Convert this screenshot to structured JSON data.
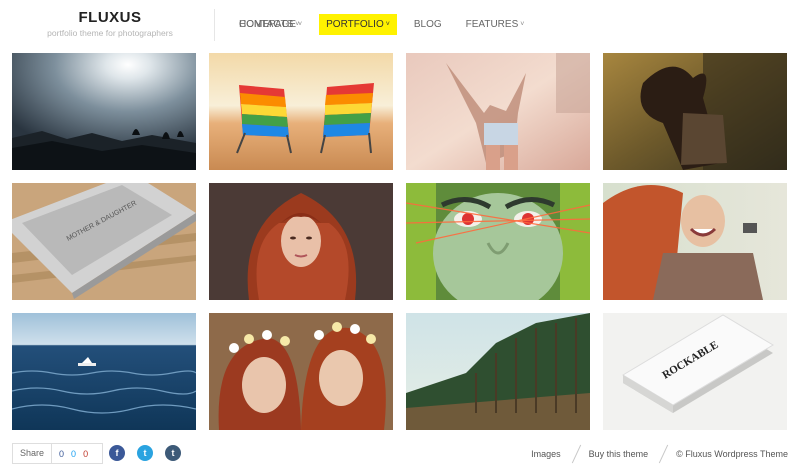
{
  "brand": {
    "title": "FLUXUS",
    "tagline": "portfolio theme for photographers"
  },
  "nav": {
    "items": [
      {
        "label": "HOMEPAGE",
        "dropdown": true,
        "active": false
      },
      {
        "label": "PORTFOLIO",
        "dropdown": true,
        "active": true
      },
      {
        "label": "BLOG",
        "dropdown": false,
        "active": false
      },
      {
        "label": "FEATURES",
        "dropdown": true,
        "active": false
      }
    ],
    "right": {
      "label": "CONTACTS",
      "dropdown": true
    },
    "caret": "˅",
    "active_color": "#fff200"
  },
  "gallery": {
    "items": [
      {
        "subject": "silhouettes on rocks against bright sun"
      },
      {
        "subject": "two striped beach chairs at sunset"
      },
      {
        "subject": "woman with raised arms in hazy light"
      },
      {
        "subject": "woman with flying hair in field"
      },
      {
        "subject": "book cover on wooden table",
        "cover_text": "MOTHER & DAUGHTER"
      },
      {
        "subject": "red curly haired woman portrait"
      },
      {
        "subject": "green face with red eyes and light streaks"
      },
      {
        "subject": "laughing red haired woman"
      },
      {
        "subject": "sea waves with small boat"
      },
      {
        "subject": "two women with flower crowns"
      },
      {
        "subject": "forest edge of tall trees"
      },
      {
        "subject": "stack of business cards",
        "card_text": "ROCKABLE"
      }
    ]
  },
  "footer": {
    "share_label": "Share",
    "counts": [
      "0",
      "0",
      "0"
    ],
    "social": [
      {
        "name": "facebook",
        "glyph": "f",
        "color": "#3b5998"
      },
      {
        "name": "twitter",
        "glyph": "t",
        "color": "#2aa3e0"
      },
      {
        "name": "tumblr",
        "glyph": "t",
        "color": "#3d5a78"
      }
    ],
    "links": [
      "Images",
      "Buy this theme",
      "© Fluxus Wordpress Theme"
    ]
  }
}
